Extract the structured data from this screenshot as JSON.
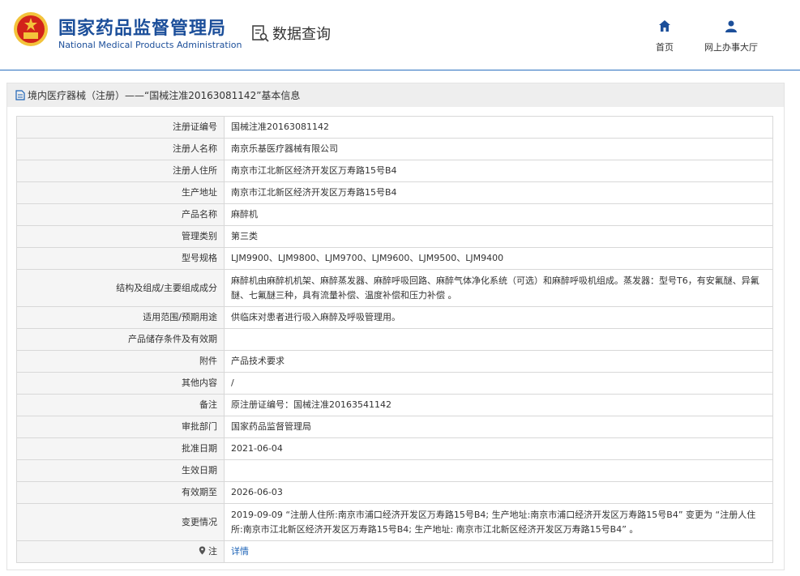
{
  "header": {
    "org_cn": "国家药品监督管理局",
    "org_en": "National Medical Products Administration",
    "data_query": "数据查询",
    "nav": {
      "home": "首页",
      "service_hall": "网上办事大厅"
    }
  },
  "panel": {
    "title": "境内医疗器械（注册）——“国械注准20163081142”基本信息"
  },
  "rows": [
    {
      "key": "注册证编号",
      "value": "国械注准20163081142"
    },
    {
      "key": "注册人名称",
      "value": "南京乐基医疗器械有限公司"
    },
    {
      "key": "注册人住所",
      "value": "南京市江北新区经济开发区万寿路15号B4"
    },
    {
      "key": "生产地址",
      "value": "南京市江北新区经济开发区万寿路15号B4"
    },
    {
      "key": "产品名称",
      "value": "麻醉机"
    },
    {
      "key": "管理类别",
      "value": "第三类"
    },
    {
      "key": "型号规格",
      "value": "LJM9900、LJM9800、LJM9700、LJM9600、LJM9500、LJM9400"
    },
    {
      "key": "结构及组成/主要组成成分",
      "value": "麻醉机由麻醉机机架、麻醉蒸发器、麻醉呼吸回路、麻醉气体净化系统（可选）和麻醉呼吸机组成。蒸发器：型号T6，有安氟醚、异氟醚、七氟醚三种，具有流量补偿、温度补偿和压力补偿 。"
    },
    {
      "key": "适用范围/预期用途",
      "value": "供临床对患者进行吸入麻醉及呼吸管理用。"
    },
    {
      "key": "产品储存条件及有效期",
      "value": ""
    },
    {
      "key": "附件",
      "value": "产品技术要求"
    },
    {
      "key": "其他内容",
      "value": "/"
    },
    {
      "key": "备注",
      "value": "原注册证编号：国械注准20163541142"
    },
    {
      "key": "审批部门",
      "value": "国家药品监督管理局"
    },
    {
      "key": "批准日期",
      "value": "2021-06-04"
    },
    {
      "key": "生效日期",
      "value": ""
    },
    {
      "key": "有效期至",
      "value": "2026-06-03"
    },
    {
      "key": "变更情况",
      "value": "2019-09-09 “注册人住所:南京市浦口经济开发区万寿路15号B4; 生产地址:南京市浦口经济开发区万寿路15号B4” 变更为 “注册人住所:南京市江北新区经济开发区万寿路15号B4; 生产地址: 南京市江北新区经济开发区万寿路15号B4” 。"
    },
    {
      "key": "注",
      "value": "详情"
    }
  ],
  "colors": {
    "brand": "#1c4f9a",
    "link": "#1c63b7",
    "emblem_red": "#d2231a",
    "emblem_gold": "#f3c33b"
  }
}
